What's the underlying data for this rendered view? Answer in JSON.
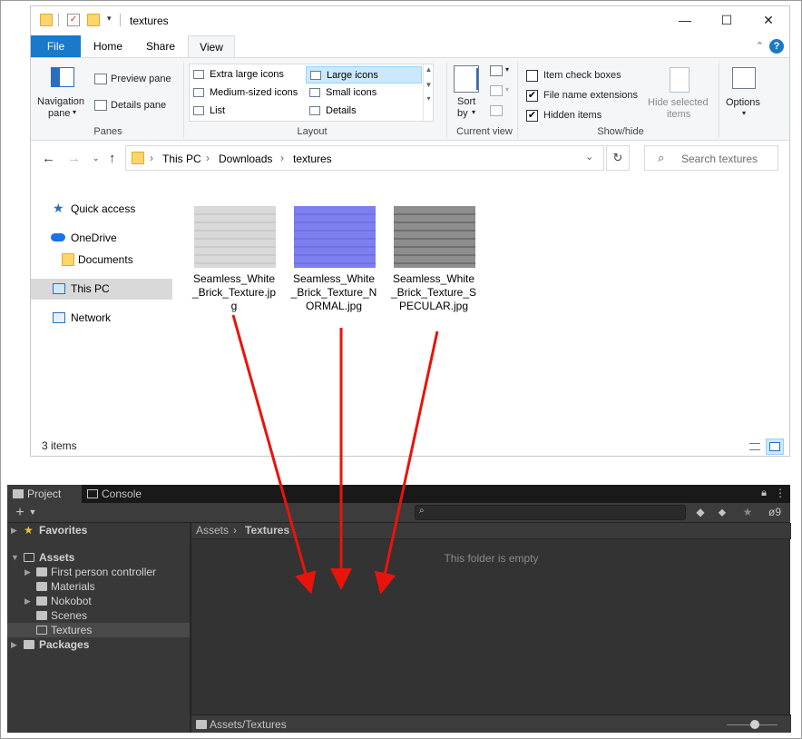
{
  "explorer": {
    "title": "textures",
    "tabs": [
      "File",
      "Home",
      "Share",
      "View"
    ],
    "active_tab": "View",
    "ribbon": {
      "panes": {
        "navigation_pane": "Navigation",
        "navigation_pane_line2": "pane",
        "preview_pane": "Preview pane",
        "details_pane": "Details pane",
        "group_label": "Panes"
      },
      "layout": {
        "items": [
          "Extra large icons",
          "Large icons",
          "Medium-sized icons",
          "Small icons",
          "List",
          "Details"
        ],
        "selected": "Large icons",
        "group_label": "Layout"
      },
      "current_view": {
        "sort_by": "Sort",
        "sort_by_line2": "by",
        "group_label": "Current view"
      },
      "show_hide": {
        "item_check_boxes": "Item check boxes",
        "file_name_extensions": "File name extensions",
        "hidden_items": "Hidden items",
        "hide_selected": "Hide selected",
        "hide_selected_line2": "items",
        "group_label": "Show/hide",
        "checked": {
          "item_check_boxes": false,
          "file_name_extensions": true,
          "hidden_items": true
        }
      },
      "options": "Options"
    },
    "address": {
      "crumbs": [
        "This PC",
        "Downloads",
        "textures"
      ]
    },
    "search_placeholder": "Search textures",
    "nav_pane": {
      "quick_access": "Quick access",
      "onedrive": "OneDrive",
      "documents": "Documents",
      "this_pc": "This PC",
      "network": "Network"
    },
    "files": [
      {
        "name": "Seamless_White_Brick_Texture.jpg",
        "thumb_color": "#d9d9d9"
      },
      {
        "name": "Seamless_White_Brick_Texture_NORMAL.jpg",
        "thumb_color": "#7d7ff0"
      },
      {
        "name": "Seamless_White_Brick_Texture_SPECULAR.jpg",
        "thumb_color": "#8e8e8e"
      }
    ],
    "status": "3 items"
  },
  "unity": {
    "tabs": [
      "Project",
      "Console"
    ],
    "toolbar_badge": "9",
    "tree": {
      "favorites": "Favorites",
      "assets": "Assets",
      "children": [
        "First person controller",
        "Materials",
        "Nokobot",
        "Scenes",
        "Textures"
      ],
      "packages": "Packages"
    },
    "breadcrumb": [
      "Assets",
      "Textures"
    ],
    "empty_message": "This folder is empty",
    "path": "Assets/Textures"
  },
  "colors": {
    "accent": "#1979ca",
    "selection": "#cce8ff",
    "arrow": "#e8140c",
    "unity_bg": "#282828"
  }
}
